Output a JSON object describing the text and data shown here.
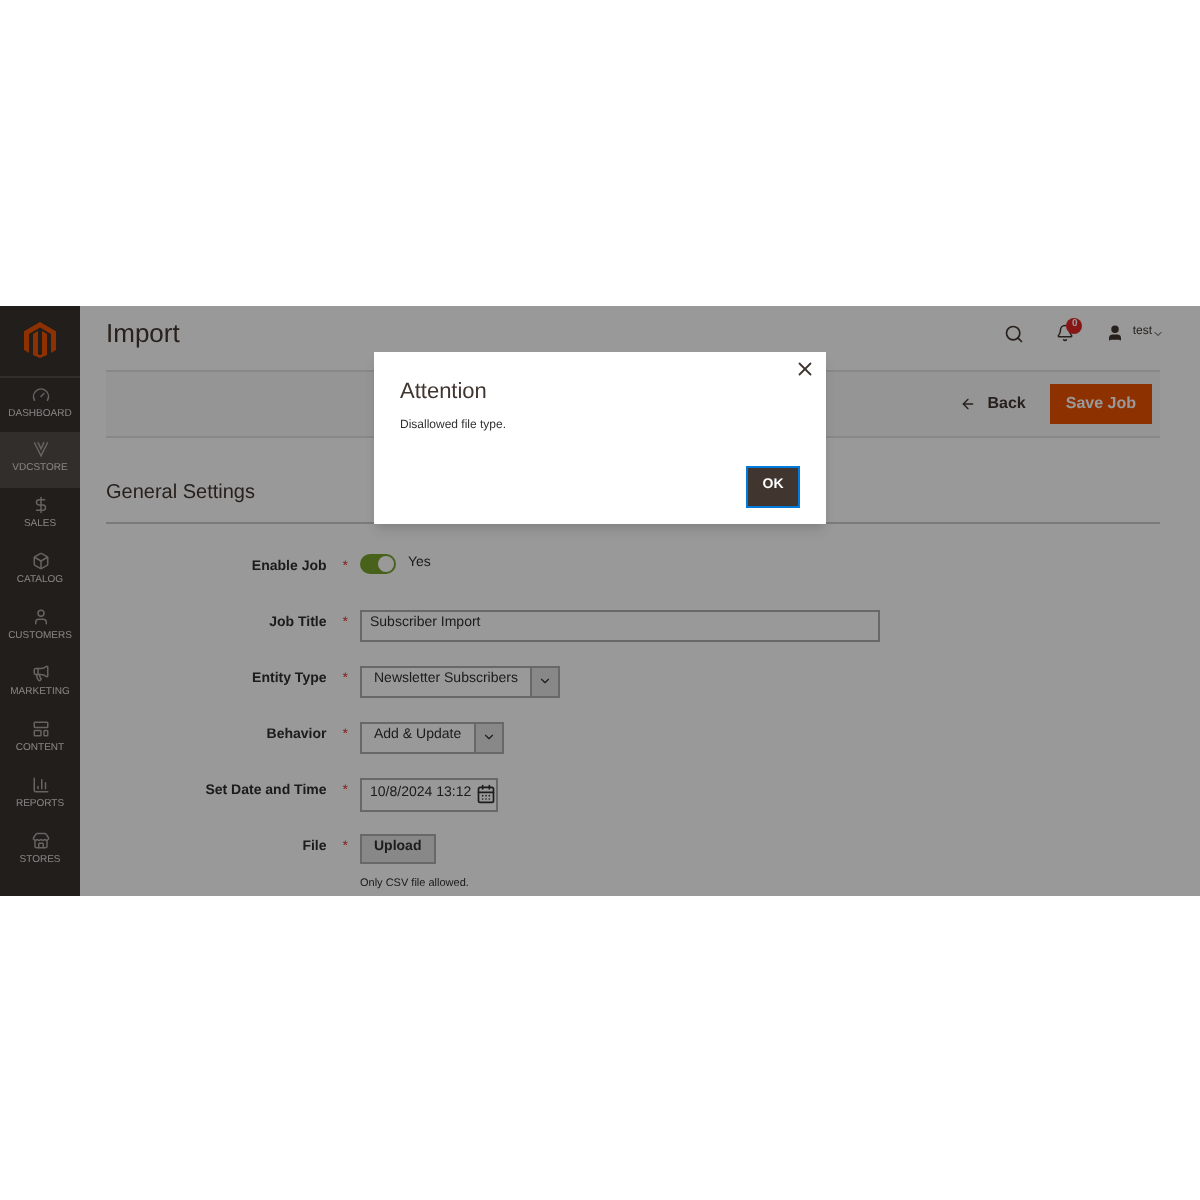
{
  "sidebar": {
    "items": [
      {
        "label": "DASHBOARD",
        "selected": false
      },
      {
        "label": "VDCSTORE",
        "selected": true
      },
      {
        "label": "SALES",
        "selected": false
      },
      {
        "label": "CATALOG",
        "selected": false
      },
      {
        "label": "CUSTOMERS",
        "selected": false
      },
      {
        "label": "MARKETING",
        "selected": false
      },
      {
        "label": "CONTENT",
        "selected": false
      },
      {
        "label": "REPORTS",
        "selected": false
      },
      {
        "label": "STORES",
        "selected": false
      }
    ]
  },
  "header": {
    "title": "Import",
    "notification_count": "0",
    "user": "test"
  },
  "actions": {
    "back": "Back",
    "save": "Save Job"
  },
  "section": {
    "title": "General Settings"
  },
  "fields": [
    {
      "kind": "toggle",
      "label": "Enable Job",
      "required_mark": "*",
      "on": true,
      "value": "Yes"
    },
    {
      "kind": "text",
      "label": "Job Title",
      "required_mark": "*",
      "value": "Subscriber Import"
    },
    {
      "kind": "select",
      "label": "Entity Type",
      "required_mark": "*",
      "value": "Newsletter Subscribers"
    },
    {
      "kind": "select",
      "label": "Behavior",
      "required_mark": "*",
      "value": "Add & Update"
    },
    {
      "kind": "datetime",
      "label": "Set Date and Time",
      "required_mark": "*",
      "value": "10/8/2024 13:12"
    },
    {
      "kind": "upload",
      "label": "File",
      "required_mark": "*",
      "value": "Upload",
      "note": "Only CSV file allowed."
    }
  ],
  "modal": {
    "title": "Attention",
    "message": "Disallowed file type.",
    "ok": "OK"
  }
}
